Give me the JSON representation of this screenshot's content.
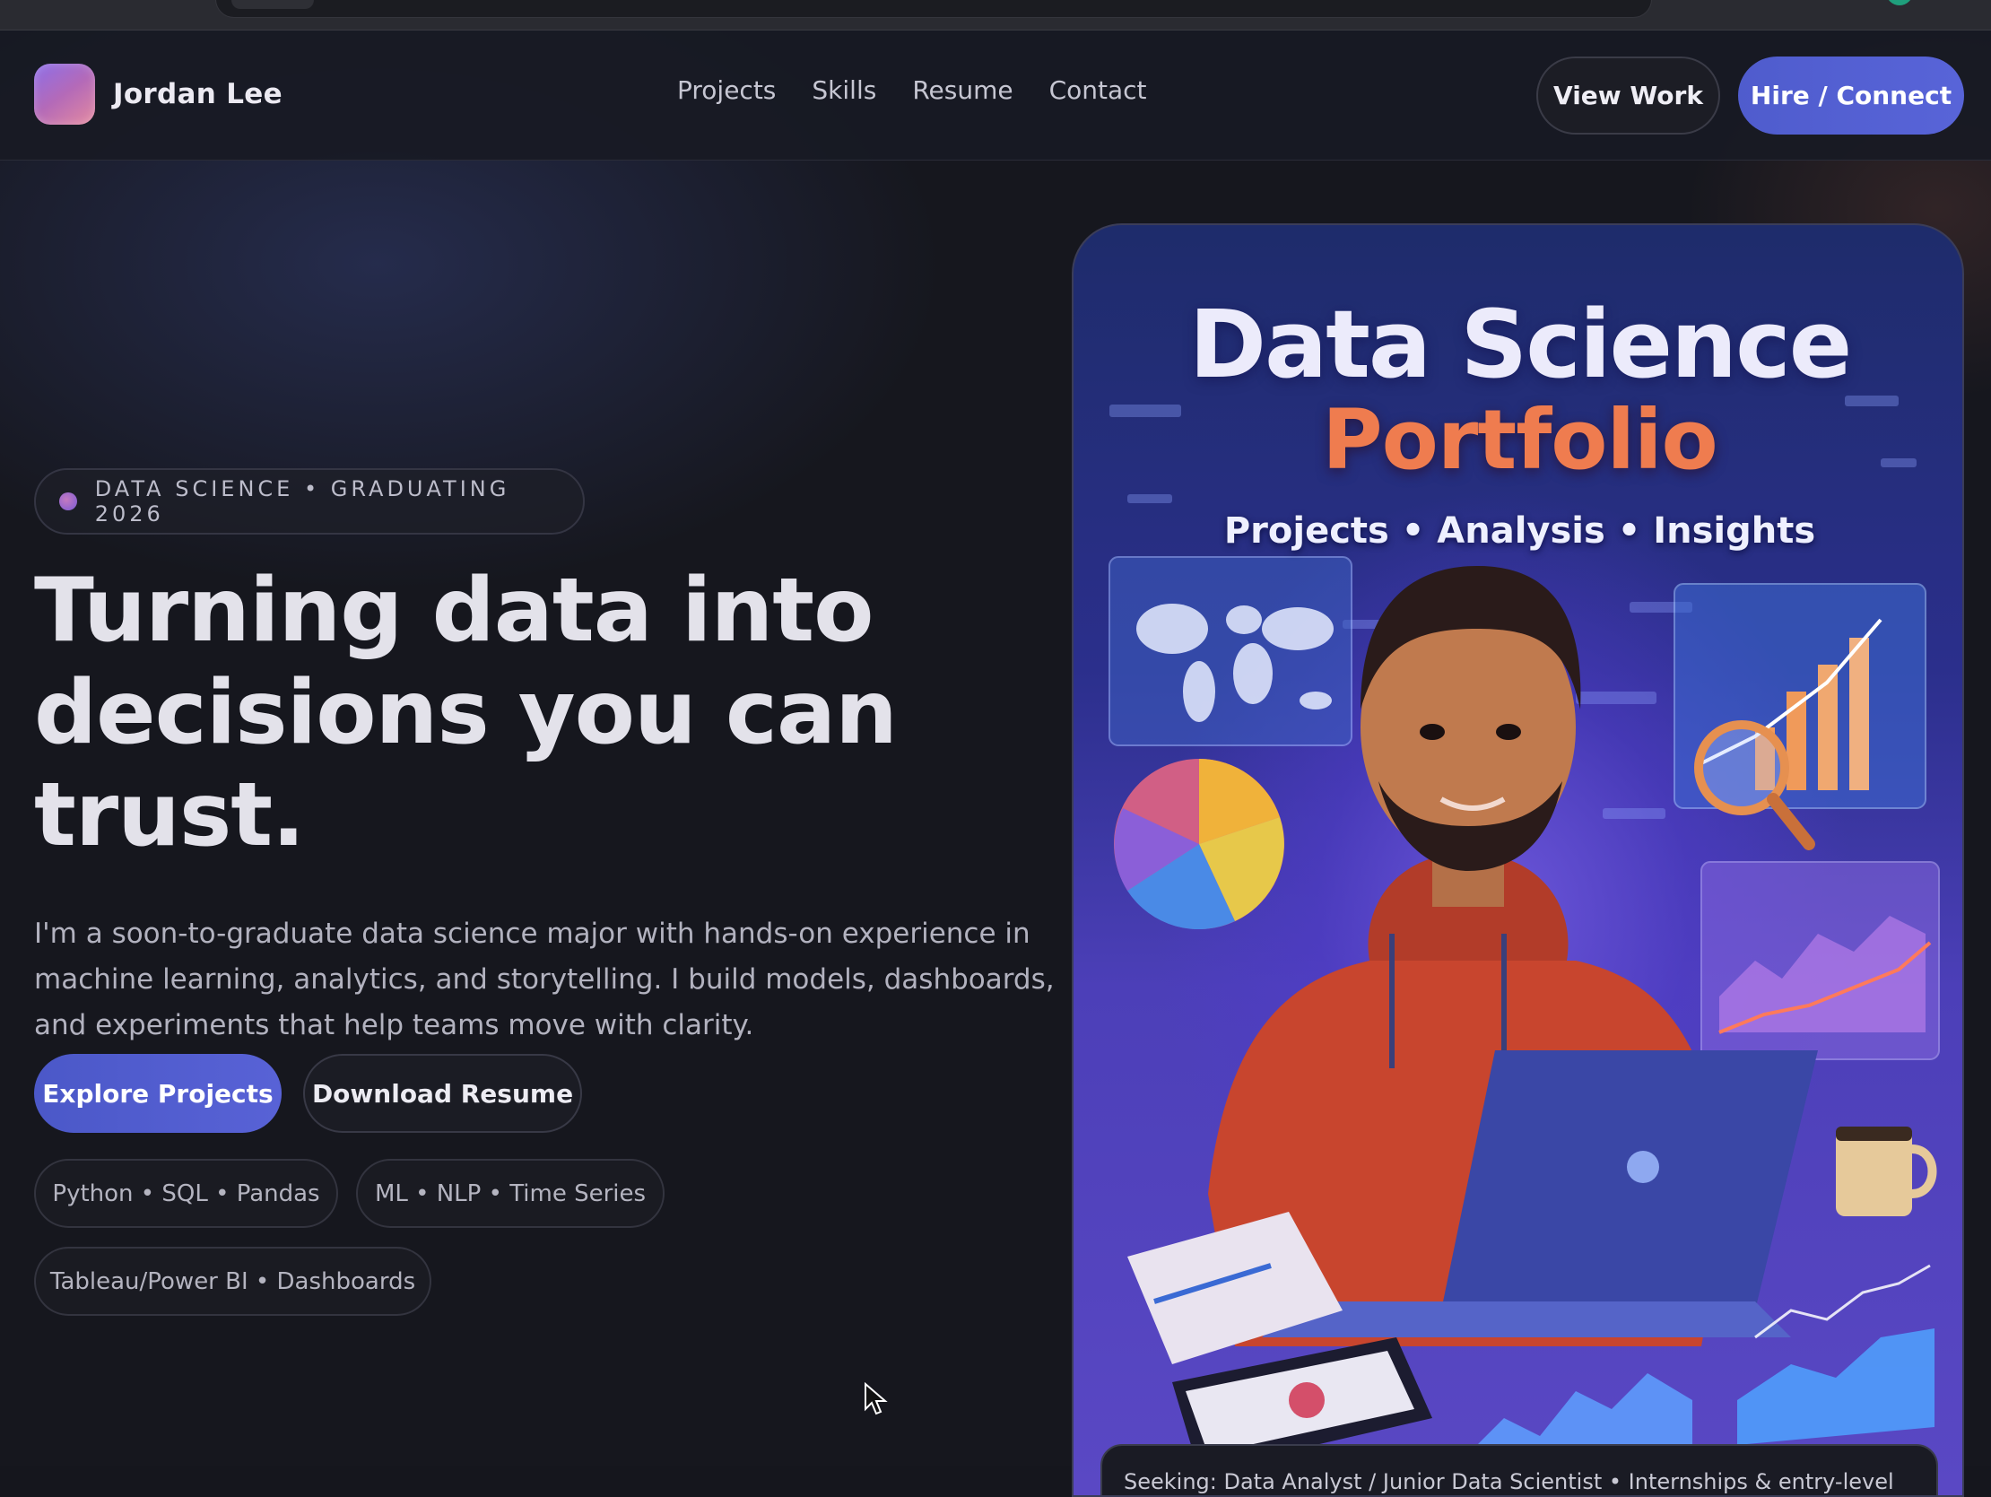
{
  "brand": {
    "name": "Jordan Lee"
  },
  "nav": {
    "links": [
      "Projects",
      "Skills",
      "Resume",
      "Contact"
    ],
    "view_work": "View Work",
    "hire": "Hire / Connect"
  },
  "hero": {
    "badge": "DATA SCIENCE • GRADUATING 2026",
    "title_lines": [
      "Turning data into",
      "decisions you can",
      "trust."
    ],
    "description": "I'm a soon-to-graduate data science major with hands-on experience in machine learning, analytics, and storytelling. I build models, dashboards, and experiments that help teams move with clarity.",
    "primary_cta": "Explore Projects",
    "secondary_cta": "Download Resume",
    "chips": [
      "Python • SQL • Pandas",
      "ML • NLP • Time Series",
      "Tableau/Power BI • Dashboards"
    ]
  },
  "hero_image": {
    "title_line1": "Data Science",
    "title_line2": "Portfolio",
    "subtitle": "Projects • Analysis • Insights",
    "caption": "Seeking: Data Analyst / Junior Data Scientist • Internships & entry-level"
  },
  "colors": {
    "accent": "#5560d4",
    "background": "#16171e",
    "portfolio_orange": "#ef7c4f"
  }
}
